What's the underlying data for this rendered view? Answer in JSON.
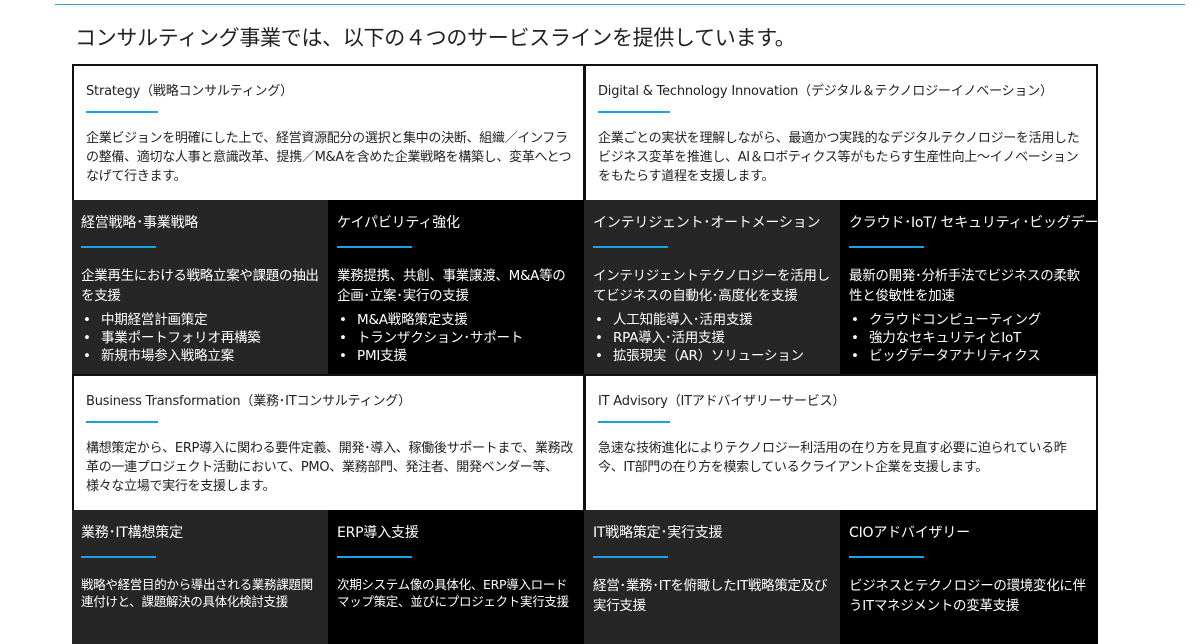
{
  "page_title": "コンサルティング事業では、以下の４つのサービスラインを提供しています。",
  "service_lines": {
    "strategy": {
      "title": "Strategy（戦略コンサルティング）",
      "desc": "企業ビジョンを明確にした上で、経営資源配分の選択と集中の決断、組織／インフラの整備、適切な人事と意識改革、提携／M&Aを含めた企業戦略を構築し、変革へとつなげて行きます。",
      "subs": [
        {
          "title": "経営戦略･事業戦略",
          "desc": "企業再生における戦略立案や課題の抽出を支援",
          "bullets": [
            "中期経営計画策定",
            "事業ポートフォリオ再構築",
            "新規市場参入戦略立案"
          ]
        },
        {
          "title": "ケイパビリティ強化",
          "desc": "業務提携、共創、事業譲渡、M&A等の企画･立案･実行の支援",
          "bullets": [
            "M&A戦略策定支援",
            "トランザクション･サポート",
            "PMI支援"
          ]
        }
      ]
    },
    "digital": {
      "title": "Digital & Technology Innovation（デジタル＆テクノロジーイノベーション）",
      "desc": "企業ごとの実状を理解しながら、最適かつ実践的なデジタルテクノロジーを活用したビジネス変革を推進し、AI＆ロボティクス等がもたらす生産性向上～イノベーションをもたらす道程を支援します。",
      "subs": [
        {
          "title": "インテリジェント･オートメーション",
          "desc": "インテリジェントテクノロジーを活用してビジネスの自動化･高度化を支援",
          "bullets": [
            "人工知能導入･活用支援",
            "RPA導入･活用支援",
            "拡張現実（AR）ソリューション"
          ]
        },
        {
          "title": "クラウド･IoT/ セキュリティ･ビッグデータ",
          "desc": "最新の開発･分析手法でビジネスの柔軟性と俊敏性を加速",
          "bullets": [
            "クラウドコンピューティング",
            "強力なセキュリティとIoT",
            "ビッグデータアナリティクス"
          ]
        }
      ]
    },
    "business": {
      "title": "Business Transformation（業務･ITコンサルティング）",
      "desc": "構想策定から、ERP導入に関わる要件定義、開発･導入、稼働後サポートまで、業務改革の一連プロジェクト活動において、PMO、業務部門、発注者、開発ベンダー等、様々な立場で実行を支援します。",
      "subs": [
        {
          "title": "業務･IT構想策定",
          "desc": "戦略や経営目的から導出される業務課題関連付けと、課題解決の具体化検討支援"
        },
        {
          "title": "ERP導入支援",
          "desc": "次期システム像の具体化、ERP導入ロードマップ策定、並びにプロジェクト実行支援"
        }
      ]
    },
    "it_advisory": {
      "title": "IT Advisory（ITアドバイザリーサービス）",
      "desc": "急速な技術進化によりテクノロジー利活用の在り方を見直す必要に迫られている昨今、IT部門の在り方を模索しているクライアント企業を支援します。",
      "subs": [
        {
          "title": "IT戦略策定･実行支援",
          "desc": "経営･業務･ITを俯瞰したIT戦略策定及び実行支援"
        },
        {
          "title": "CIOアドバイザリー",
          "desc": "ビジネスとテクノロジーの環境変化に伴うITマネジメントの変革支援"
        }
      ]
    }
  }
}
